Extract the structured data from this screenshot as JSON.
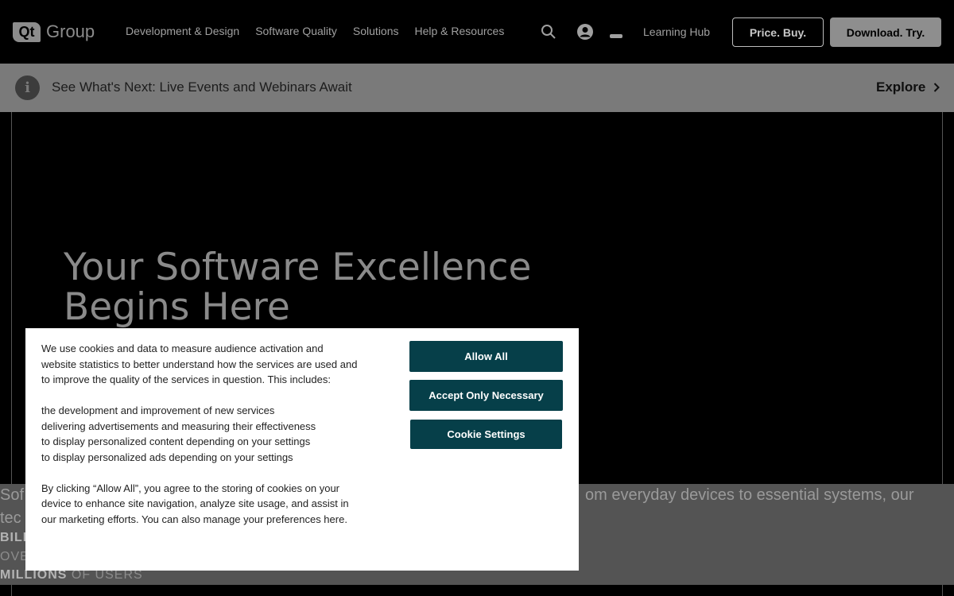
{
  "header": {
    "logo_mark": "Qt",
    "logo_text": "Group",
    "nav": [
      "Development & Design",
      "Software Quality",
      "Solutions",
      "Help & Resources"
    ],
    "learning_hub": "Learning Hub",
    "price_button": "Price. Buy.",
    "download_button": "Download. Try.",
    "icons": [
      "search-icon",
      "user-icon",
      "minus-icon"
    ]
  },
  "announcement": {
    "icon": "info-icon",
    "text": "See What's Next: Live Events and Webinars Await",
    "link": "Explore"
  },
  "hero": {
    "title_line1": "Your Software Excellence",
    "title_line2": "Begins Here"
  },
  "stats": {
    "partial_text_left_1": "Sof",
    "partial_text_left_2": "tec",
    "partial_text_right": "om everyday devices to essential systems, our",
    "billions_partial": "BILL",
    "over_partial": "OVE",
    "millions_strong": "MILLIONS",
    "millions_rest": " OF USERS"
  },
  "cookie": {
    "intro": "We use cookies and data to measure audience activation and website statistics to better understand how the services are used and to improve the quality of the services in question. This includes:",
    "items": [
      "the development and improvement of new services",
      "delivering advertisements and measuring their effectiveness",
      "to display personalized content depending on your settings",
      "to display personalized ads depending on your settings"
    ],
    "closing": "By clicking “Allow All”, you agree to the storing of cookies on your device to enhance site navigation, analyze site usage, and assist in our marketing efforts. You can also manage your preferences here.",
    "allow_all": "Allow All",
    "accept_necessary": "Accept Only Necessary",
    "settings": "Cookie Settings"
  },
  "colors": {
    "cookie_button": "#063f49",
    "banner_bg": "#7a7a7a",
    "page_bg": "#000000"
  }
}
